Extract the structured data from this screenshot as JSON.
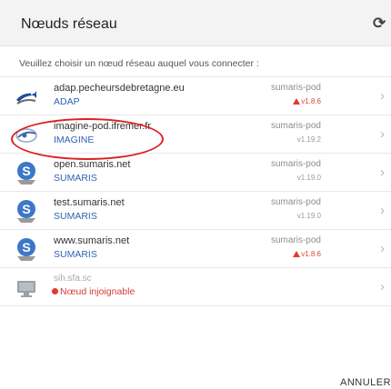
{
  "header": {
    "title": "Nœuds réseau",
    "refresh_icon": "refresh-icon"
  },
  "prompt": "Veuillez choisir un nœud réseau auquel vous connecter :",
  "nodes": [
    {
      "host": "adap.pecheursdebretagne.eu",
      "label": "ADAP",
      "pod": "sumaris-pod",
      "version": "v1.8.6",
      "outdated": true,
      "icon": "adap-fish-icon"
    },
    {
      "host": "imagine-pod.ifremer.fr",
      "label": "IMAGINE",
      "pod": "sumaris-pod",
      "version": "v1.19.2",
      "outdated": false,
      "icon": "imagine-logo-icon"
    },
    {
      "host": "open.sumaris.net",
      "label": "SUMARIS",
      "pod": "sumaris-pod",
      "version": "v1.19.0",
      "outdated": false,
      "icon": "sumaris-logo-icon"
    },
    {
      "host": "test.sumaris.net",
      "label": "SUMARIS",
      "pod": "sumaris-pod",
      "version": "v1.19.0",
      "outdated": false,
      "icon": "sumaris-logo-icon"
    },
    {
      "host": "www.sumaris.net",
      "label": "SUMARIS",
      "pod": "sumaris-pod",
      "version": "v1.8.6",
      "outdated": true,
      "icon": "sumaris-logo-icon"
    },
    {
      "host": "sih.sfa.sc",
      "error": "Nœud injoignable",
      "icon": "monitor-icon"
    }
  ],
  "footer": {
    "cancel_label": "ANNULER"
  },
  "colors": {
    "accent_blue": "#2e63b3",
    "warning_red": "#e13a2f",
    "highlight_red": "#dd1f25"
  }
}
